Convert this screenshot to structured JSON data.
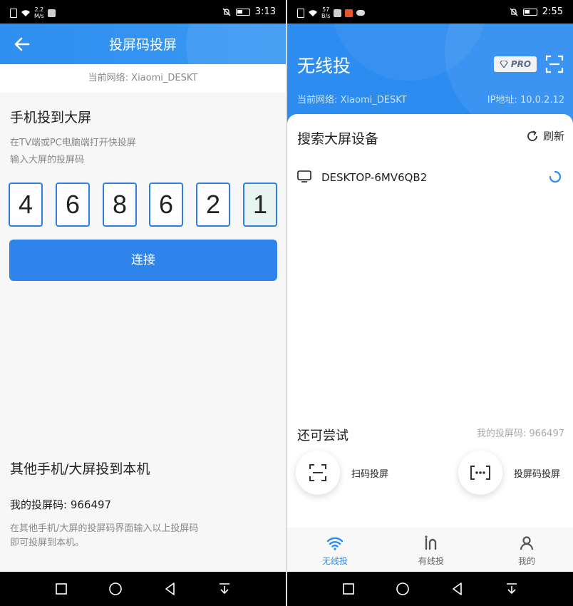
{
  "left_screen": {
    "status_bar": {
      "speed_value": "2.2",
      "speed_unit": "M/s",
      "time": "3:13"
    },
    "header": {
      "title": "投屏码投屏"
    },
    "network": "当前网络: Xiaomi_DESKT",
    "cast_section": {
      "title": "手机投到大屏",
      "hint_line1": "在TV端或PC电脑端打开快投屏",
      "hint_line2": "输入大屏的投屏码",
      "code_digits": [
        "4",
        "6",
        "8",
        "6",
        "2",
        "1"
      ]
    },
    "connect_button": "连接",
    "receive_section": {
      "title": "其他手机/大屏投到本机",
      "my_code": "我的投屏码: 966497",
      "hint_line1": "在其他手机/大屏的投屏码界面输入以上投屏码",
      "hint_line2": "即可投屏到本机。"
    }
  },
  "right_screen": {
    "status_bar": {
      "speed_value": "57",
      "speed_unit": "B/s",
      "time": "2:55"
    },
    "header": {
      "title": "无线投",
      "pro_badge": "PRO",
      "network": "当前网络: Xiaomi_DESKT",
      "ip": "IP地址: 10.0.2.12"
    },
    "search": {
      "title": "搜索大屏设备",
      "refresh_label": "刷新"
    },
    "devices": [
      {
        "name": "DESKTOP-6MV6QB2"
      }
    ],
    "try_more": {
      "title": "还可尝试",
      "my_code": "我的投屏码: 966497",
      "options": [
        {
          "label": "扫码投屏",
          "icon": "scan-icon"
        },
        {
          "label": "投屏码投屏",
          "icon": "code-dots-icon"
        }
      ]
    },
    "tabs": [
      {
        "label": "无线投",
        "icon": "wifi-icon",
        "active": true
      },
      {
        "label": "有线投",
        "icon": "cable-icon",
        "active": false
      },
      {
        "label": "我的",
        "icon": "person-icon",
        "active": false
      }
    ]
  },
  "colors": {
    "primary": "#2d8cf0",
    "button": "#2e84ea",
    "code_border": "#2e7ee6",
    "code_active_bg": "#e7f4ef"
  }
}
